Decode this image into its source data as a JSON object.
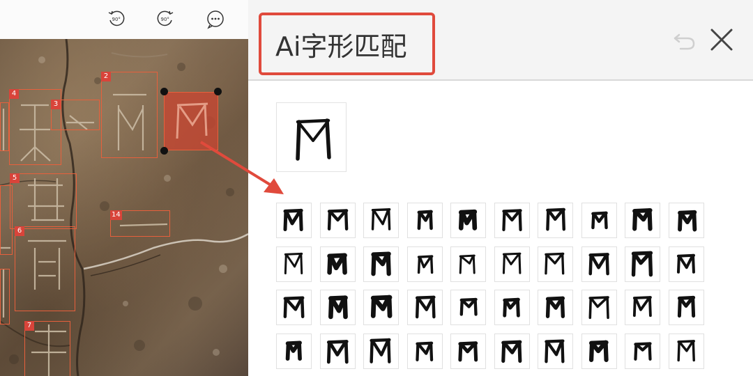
{
  "viewer": {
    "toolbar": {
      "rotate_left_label": "90°",
      "rotate_right_label": "90°",
      "more_icon": "ellipsis-icon"
    },
    "regions": [
      {
        "id": "4"
      },
      {
        "id": "3"
      },
      {
        "id": "2"
      },
      {
        "id": "5"
      },
      {
        "id": "14"
      },
      {
        "id": "6"
      },
      {
        "id": "7"
      }
    ],
    "colors": {
      "box": "#e8603c",
      "tag": "#d9443a",
      "selection": "#c84632"
    }
  },
  "panel": {
    "title": "Ai字形匹配",
    "undo_icon": "undo-icon",
    "close_icon": "close-icon",
    "accent": "#e04a3c",
    "match_rows": 4,
    "match_cols": 10
  }
}
